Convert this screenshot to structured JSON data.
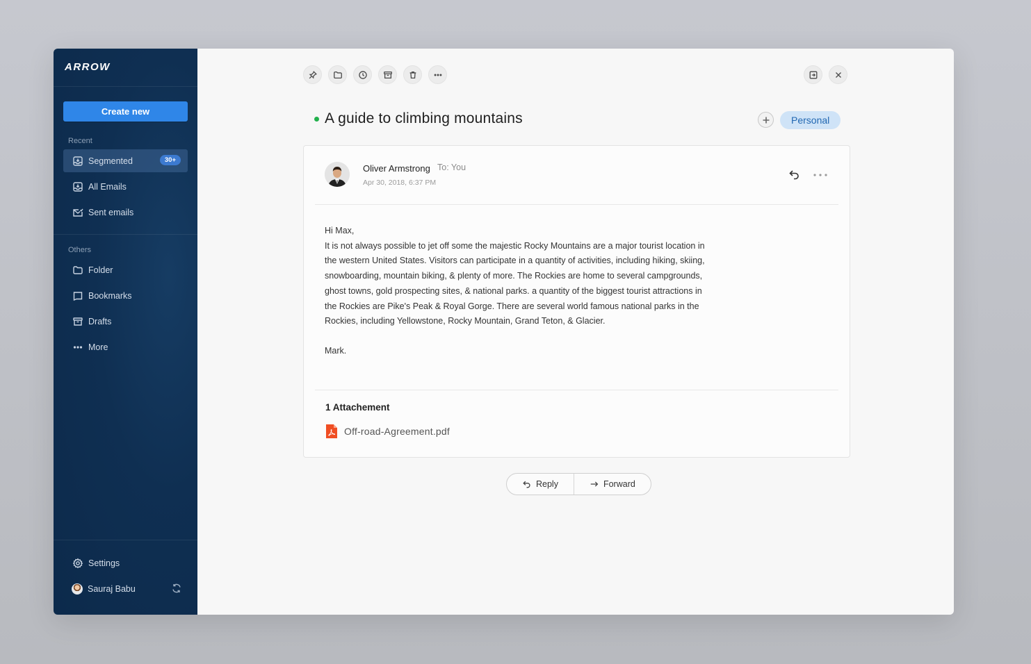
{
  "app": {
    "logo": "ARROW"
  },
  "sidebar": {
    "create_label": "Create new",
    "recent_label": "Recent",
    "recent_items": [
      {
        "label": "Segmented",
        "icon": "inbox-icon",
        "badge": "30+",
        "active": true
      },
      {
        "label": "All Emails",
        "icon": "inbox-download-icon"
      },
      {
        "label": "Sent emails",
        "icon": "mail-sent-icon"
      }
    ],
    "others_label": "Others",
    "other_items": [
      {
        "label": "Folder",
        "icon": "folder-icon"
      },
      {
        "label": "Bookmarks",
        "icon": "bookmark-icon"
      },
      {
        "label": "Drafts",
        "icon": "archive-icon"
      },
      {
        "label": "More",
        "icon": "more-dots-icon"
      }
    ],
    "settings_label": "Settings",
    "user_name": "Sauraj Babu"
  },
  "email": {
    "title": "A guide to climbing mountains",
    "tag": "Personal",
    "sender": "Oliver Armstrong",
    "to": "To: You",
    "date": "Apr 30, 2018, 6:37 PM",
    "greeting": "Hi Max,",
    "body": [
      "It is not always possible to jet off some the majestic Rocky Mountains are a major tourist location in",
      "the western United States. Visitors can participate in a quantity of activities, including hiking, skiing,",
      "snowboarding, mountain biking, & plenty of more. The Rockies are home to several campgrounds,",
      "ghost towns, gold prospecting sites, & national parks. a quantity of the biggest tourist attractions in",
      "the Rockies are Pike's Peak & Royal Gorge. There are several world famous national parks in the",
      "Rockies, including Yellowstone, Rocky Mountain, Grand Teton, & Glacier."
    ],
    "signature": "Mark.",
    "attachment_title": "1 Attachement",
    "attachment_name": "Off-road-Agreement.pdf"
  },
  "actions": {
    "reply": "Reply",
    "forward": "Forward"
  },
  "colors": {
    "accent": "#2f86e8",
    "sidebar": "#0f2f52",
    "status": "#22b14c",
    "tag_bg": "#cfe3f7"
  }
}
